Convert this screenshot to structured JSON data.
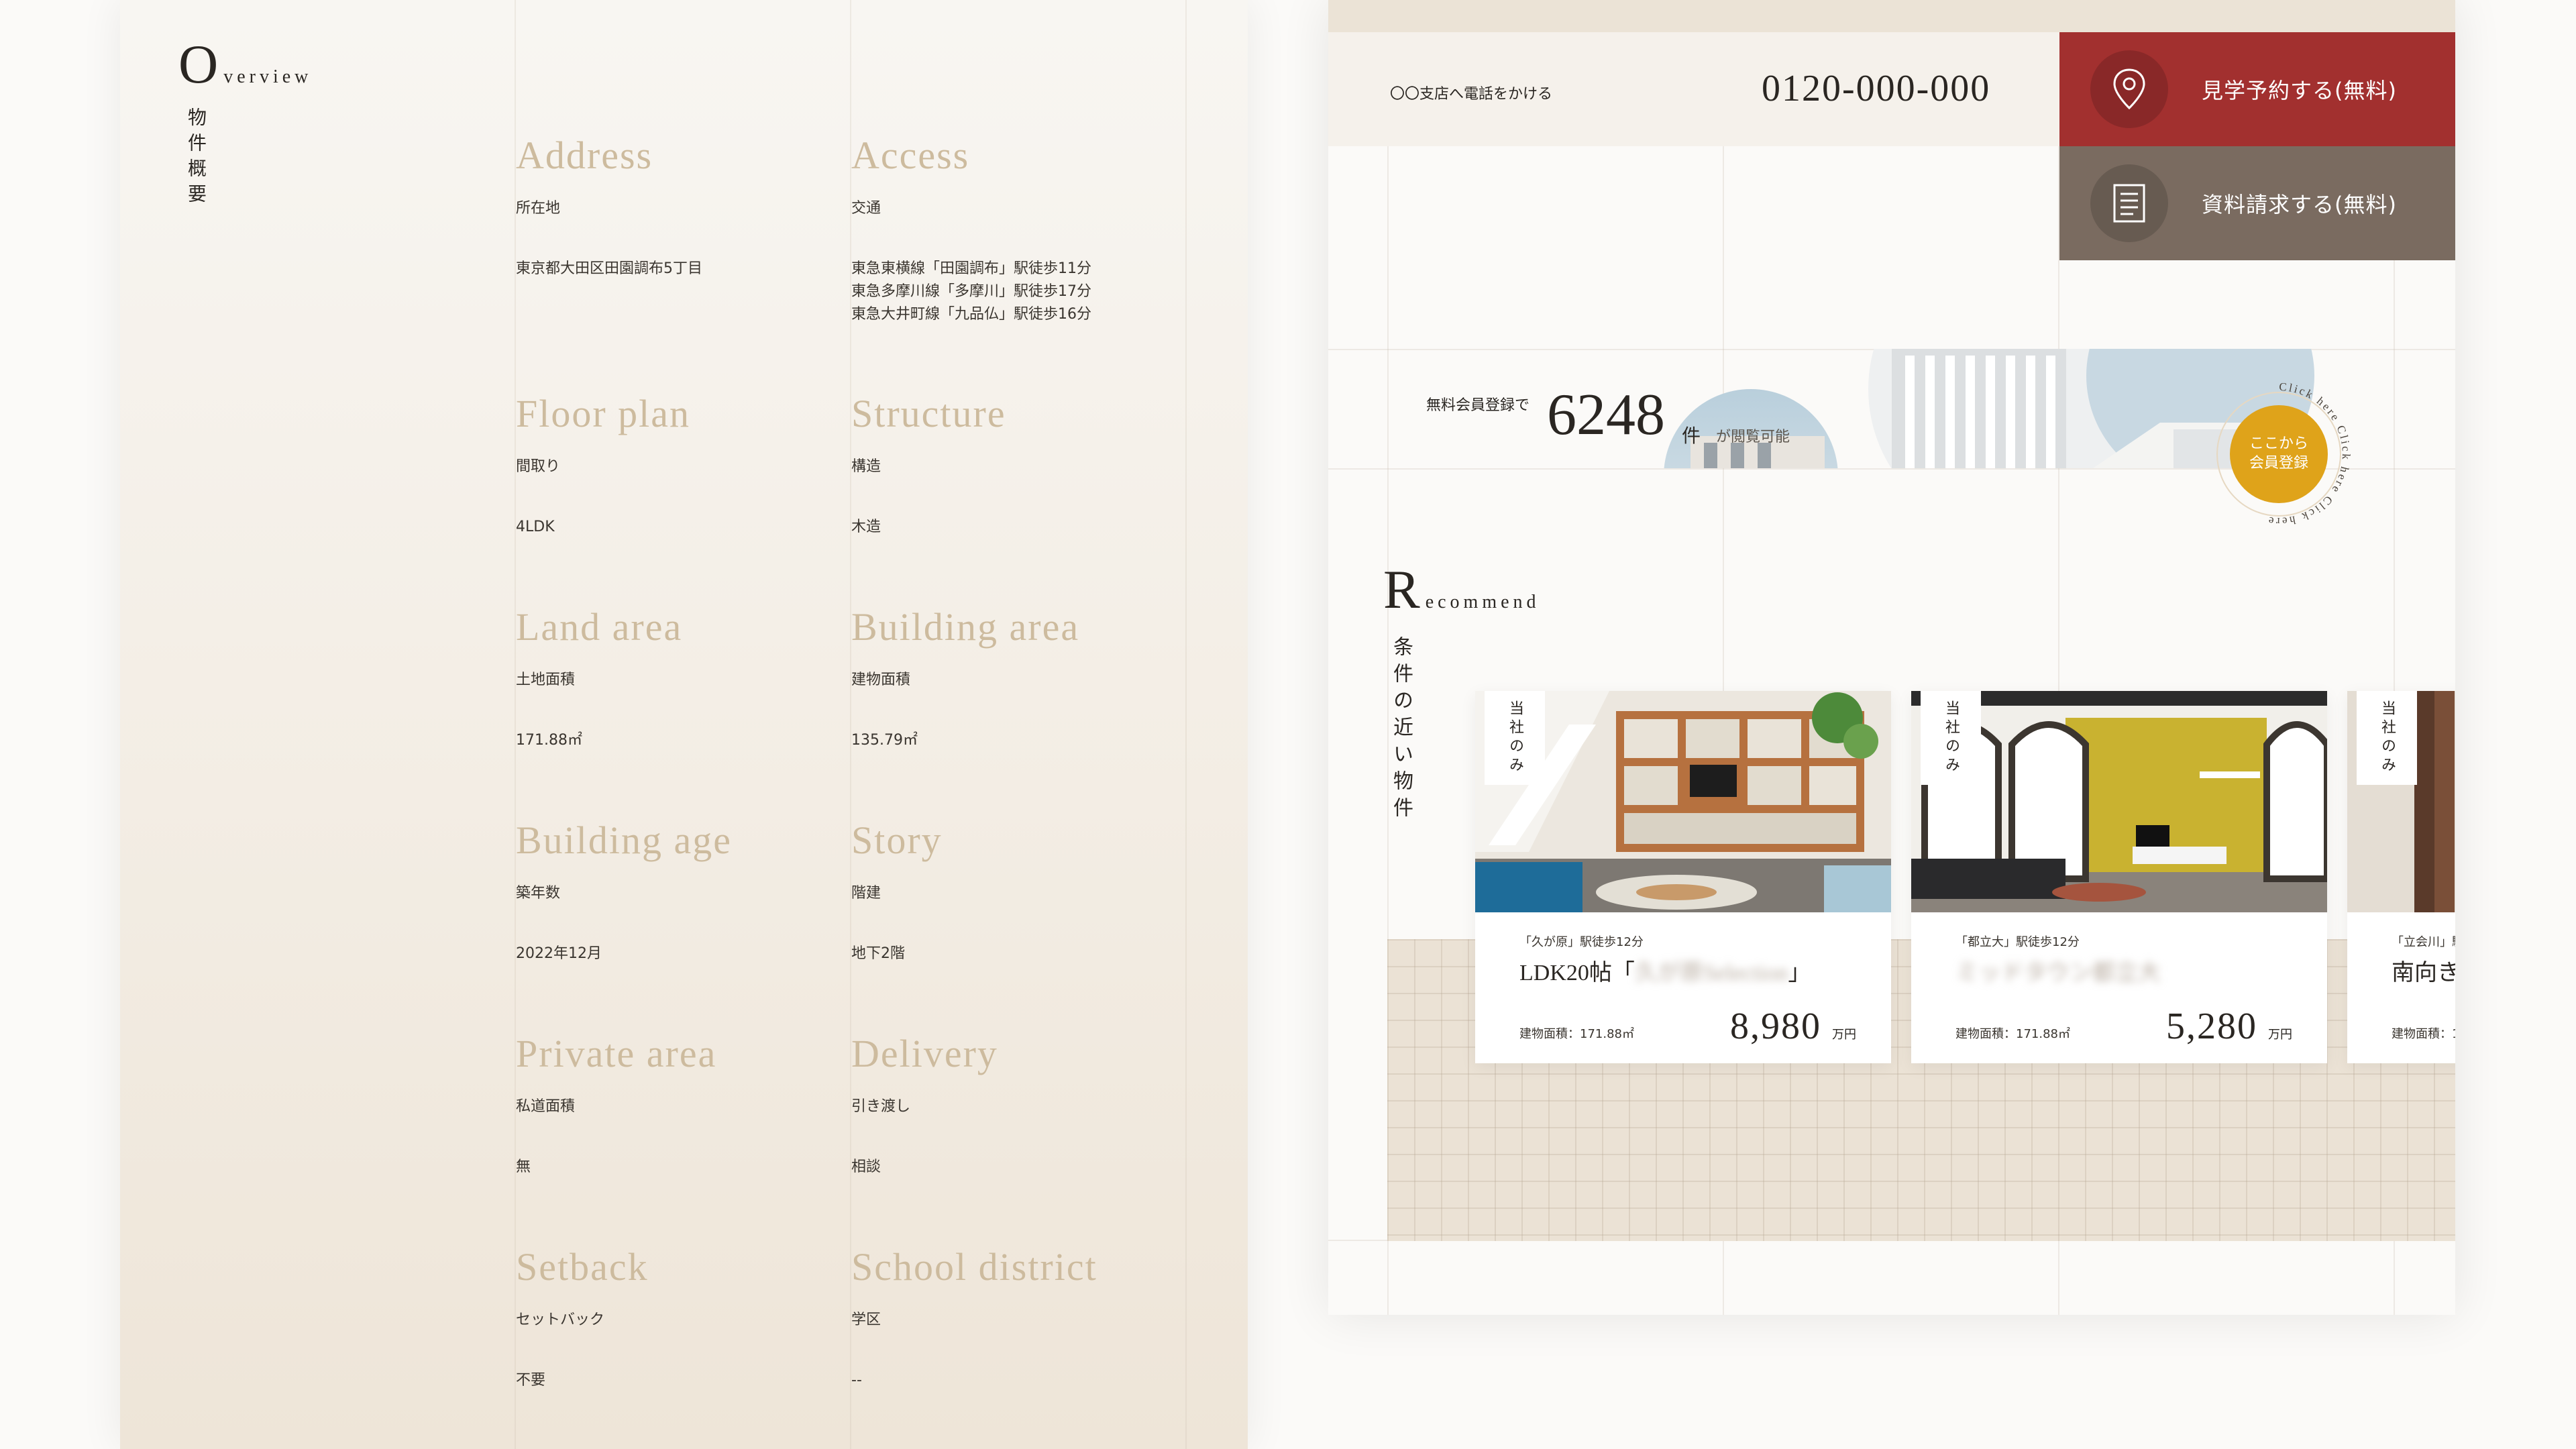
{
  "overview": {
    "heading_initial": "O",
    "heading_rest": "verview",
    "heading_jp": "物件概要",
    "items": [
      {
        "en": "Address",
        "label": "所在地",
        "value": "東京都大田区田園調布5丁目"
      },
      {
        "en": "Access",
        "label": "交通",
        "value": "東急東横線「田園調布」駅徒歩11分\n東急多摩川線「多摩川」駅徒歩17分\n東急大井町線「九品仏」駅徒歩16分"
      },
      {
        "en": "Floor plan",
        "label": "間取り",
        "value": "4LDK"
      },
      {
        "en": "Structure",
        "label": "構造",
        "value": "木造"
      },
      {
        "en": "Land area",
        "label": "土地面積",
        "value": "171.88㎡"
      },
      {
        "en": "Building area",
        "label": "建物面積",
        "value": "135.79㎡"
      },
      {
        "en": "Building age",
        "label": "築年数",
        "value": "2022年12月"
      },
      {
        "en": "Story",
        "label": "階建",
        "value": "地下2階"
      },
      {
        "en": "Private area",
        "label": "私道面積",
        "value": "無"
      },
      {
        "en": "Delivery",
        "label": "引き渡し",
        "value": "相談"
      },
      {
        "en": "Setback",
        "label": "セットバック",
        "value": "不要"
      },
      {
        "en": "School district",
        "label": "学区",
        "value": "--"
      }
    ]
  },
  "contact": {
    "phone_label": "〇〇支店へ電話をかける",
    "phone_number": "0120-000-000",
    "reserve_label": "見学予約する(無料)",
    "docs_label": "資料請求する(無料)",
    "reserve_color": "#a2302f",
    "docs_color": "#7a6b60",
    "reserve_icon": "location-pin-icon",
    "docs_icon": "document-icon"
  },
  "listing_count": {
    "prefix": "無料会員登録で",
    "number": "6248",
    "unit": "件",
    "suffix": "が閲覧可能"
  },
  "register": {
    "line1": "ここから",
    "line2": "会員登録",
    "ring_text": "Click here Click here Click here",
    "color": "#dfa31a"
  },
  "recommend": {
    "heading_initial": "R",
    "heading_rest": "ecommend",
    "heading_jp": "条件の近い物件",
    "cards": [
      {
        "tag": "当社のみ",
        "station": "「久が原」駅徒歩12分",
        "title_prefix": "LDK20帖「",
        "title_blurred": "久が原Selection",
        "title_suffix": "」",
        "area": "建物面積：171.88㎡",
        "price": "8,980",
        "unit": "万円"
      },
      {
        "tag": "当社のみ",
        "station": "「都立大」駅徒歩12分",
        "title_prefix": "",
        "title_blurred": "ミッドタウン都立大",
        "title_suffix": "",
        "area": "建物面積：171.88㎡",
        "price": "5,280",
        "unit": "万円"
      },
      {
        "tag": "当社のみ",
        "station": "「立会川」駅",
        "title_prefix": "南向き",
        "title_blurred": "",
        "title_suffix": "",
        "area": "建物面積：1",
        "price": "",
        "unit": ""
      }
    ]
  }
}
